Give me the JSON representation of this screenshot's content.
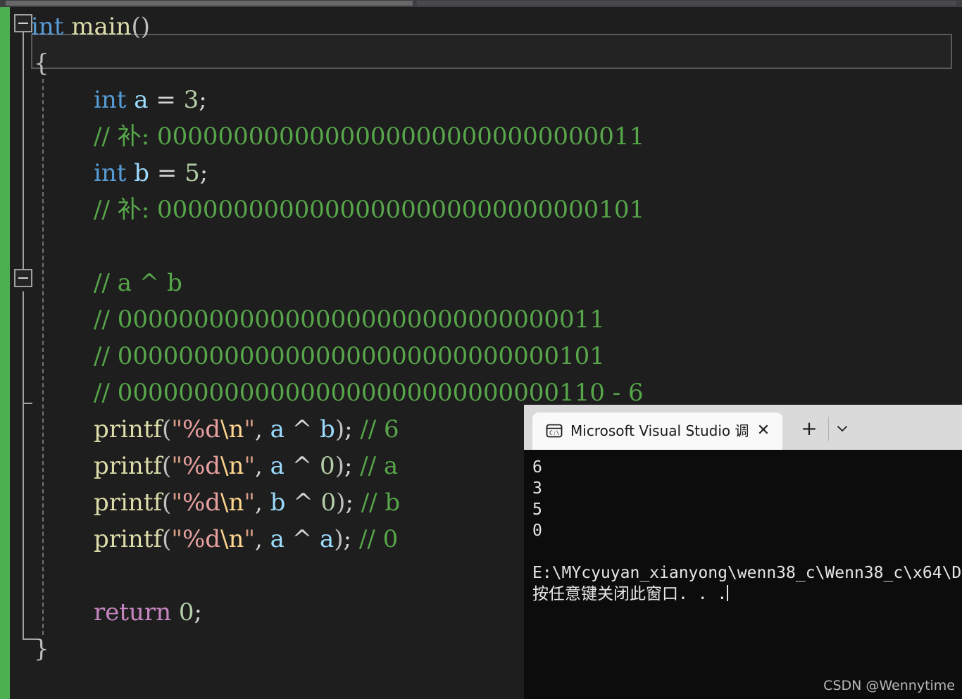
{
  "editor": {
    "background_color": "#1e1e1e",
    "change_bar_color": "#4caf50",
    "lines": [
      {
        "id": "l1",
        "indent": 0,
        "text": "int main()"
      },
      {
        "id": "l2",
        "indent": 1,
        "text": "{"
      },
      {
        "id": "l3",
        "indent": 2,
        "text": "int a = 3;"
      },
      {
        "id": "l4",
        "indent": 2,
        "text": "// 补: 00000000000000000000000000000011"
      },
      {
        "id": "l5",
        "indent": 2,
        "text": "int b = 5;"
      },
      {
        "id": "l6",
        "indent": 2,
        "text": "// 补: 00000000000000000000000000000101"
      },
      {
        "id": "l7",
        "indent": 2,
        "text": ""
      },
      {
        "id": "l8",
        "indent": 2,
        "text": "// a ^ b"
      },
      {
        "id": "l9",
        "indent": 2,
        "text": "// 00000000000000000000000000000011"
      },
      {
        "id": "l10",
        "indent": 2,
        "text": "// 00000000000000000000000000000101"
      },
      {
        "id": "l11",
        "indent": 2,
        "text": "// 00000000000000000000000000000110 - 6"
      },
      {
        "id": "l12",
        "indent": 2,
        "text": "printf(\"%d\\n\", a ^ b); // 6"
      },
      {
        "id": "l13",
        "indent": 2,
        "text": "printf(\"%d\\n\", a ^ 0); // a"
      },
      {
        "id": "l14",
        "indent": 2,
        "text": "printf(\"%d\\n\", b ^ 0); // b"
      },
      {
        "id": "l15",
        "indent": 2,
        "text": "printf(\"%d\\n\", a ^ a); // 0"
      },
      {
        "id": "l16",
        "indent": 2,
        "text": ""
      },
      {
        "id": "l17",
        "indent": 2,
        "text": "return 0;"
      },
      {
        "id": "l18",
        "indent": 1,
        "text": "}"
      }
    ],
    "tokens": {
      "l1": [
        [
          "kw",
          "int"
        ],
        [
          "punc",
          " "
        ],
        [
          "fn",
          "main"
        ],
        [
          "paren",
          "()"
        ]
      ],
      "l2": [
        [
          "paren",
          "{"
        ]
      ],
      "l3": [
        [
          "kw",
          "int"
        ],
        [
          "punc",
          " "
        ],
        [
          "var",
          "a"
        ],
        [
          "punc",
          " = "
        ],
        [
          "num",
          "3"
        ],
        [
          "punc",
          ";"
        ]
      ],
      "l4": [
        [
          "cmt",
          "// 补: 00000000000000000000000000000011"
        ]
      ],
      "l5": [
        [
          "kw",
          "int"
        ],
        [
          "punc",
          " "
        ],
        [
          "var",
          "b"
        ],
        [
          "punc",
          " = "
        ],
        [
          "num",
          "5"
        ],
        [
          "punc",
          ";"
        ]
      ],
      "l6": [
        [
          "cmt",
          "// 补: 00000000000000000000000000000101"
        ]
      ],
      "l7": [],
      "l8": [
        [
          "cmt",
          "// a ^ b"
        ]
      ],
      "l9": [
        [
          "cmt",
          "// 00000000000000000000000000000011"
        ]
      ],
      "l10": [
        [
          "cmt",
          "// 00000000000000000000000000000101"
        ]
      ],
      "l11": [
        [
          "cmt",
          "// 00000000000000000000000000000110 - 6"
        ]
      ],
      "l12": [
        [
          "fn",
          "printf"
        ],
        [
          "paren",
          "("
        ],
        [
          "str",
          "\""
        ],
        [
          "fmt",
          "%d"
        ],
        [
          "esc",
          "\\n"
        ],
        [
          "str",
          "\""
        ],
        [
          "punc",
          ", "
        ],
        [
          "var",
          "a"
        ],
        [
          "punc",
          " ^ "
        ],
        [
          "var",
          "b"
        ],
        [
          "paren",
          ")"
        ],
        [
          "punc",
          "; "
        ],
        [
          "cmt",
          "// 6"
        ]
      ],
      "l13": [
        [
          "fn",
          "printf"
        ],
        [
          "paren",
          "("
        ],
        [
          "str",
          "\""
        ],
        [
          "fmt",
          "%d"
        ],
        [
          "esc",
          "\\n"
        ],
        [
          "str",
          "\""
        ],
        [
          "punc",
          ", "
        ],
        [
          "var",
          "a"
        ],
        [
          "punc",
          " ^ "
        ],
        [
          "num",
          "0"
        ],
        [
          "paren",
          ")"
        ],
        [
          "punc",
          "; "
        ],
        [
          "cmt",
          "// a"
        ]
      ],
      "l14": [
        [
          "fn",
          "printf"
        ],
        [
          "paren",
          "("
        ],
        [
          "str",
          "\""
        ],
        [
          "fmt",
          "%d"
        ],
        [
          "esc",
          "\\n"
        ],
        [
          "str",
          "\""
        ],
        [
          "punc",
          ", "
        ],
        [
          "var",
          "b"
        ],
        [
          "punc",
          " ^ "
        ],
        [
          "num",
          "0"
        ],
        [
          "paren",
          ")"
        ],
        [
          "punc",
          "; "
        ],
        [
          "cmt",
          "// b"
        ]
      ],
      "l15": [
        [
          "fn",
          "printf"
        ],
        [
          "paren",
          "("
        ],
        [
          "str",
          "\""
        ],
        [
          "fmt",
          "%d"
        ],
        [
          "esc",
          "\\n"
        ],
        [
          "str",
          "\""
        ],
        [
          "punc",
          ", "
        ],
        [
          "var",
          "a"
        ],
        [
          "punc",
          " ^ "
        ],
        [
          "var",
          "a"
        ],
        [
          "paren",
          ")"
        ],
        [
          "punc",
          "; "
        ],
        [
          "cmt",
          "// 0"
        ]
      ],
      "l16": [],
      "l17": [
        [
          "kw2",
          "return"
        ],
        [
          "punc",
          " "
        ],
        [
          "num",
          "0"
        ],
        [
          "punc",
          ";"
        ]
      ],
      "l18": [
        [
          "paren",
          "}"
        ]
      ]
    },
    "fold_markers": [
      {
        "name": "fold-toggle-main",
        "state": "expanded",
        "glyph": "−"
      },
      {
        "name": "fold-toggle-block",
        "state": "expanded",
        "glyph": "−"
      }
    ]
  },
  "console": {
    "tab": {
      "icon": "terminal-icon",
      "title": "Microsoft Visual Studio 调试控",
      "close_label": "✕",
      "new_tab_label": "+",
      "menu_label": "⌄"
    },
    "output_lines": [
      "6",
      "3",
      "5",
      "0",
      "",
      "E:\\MYcyuyan_xianyong\\wenn38_c\\Wenn38_c\\x64\\D",
      "按任意键关闭此窗口. . ."
    ],
    "background_color": "#0c0c0c"
  },
  "watermark": {
    "text": "CSDN @Wennytime"
  }
}
